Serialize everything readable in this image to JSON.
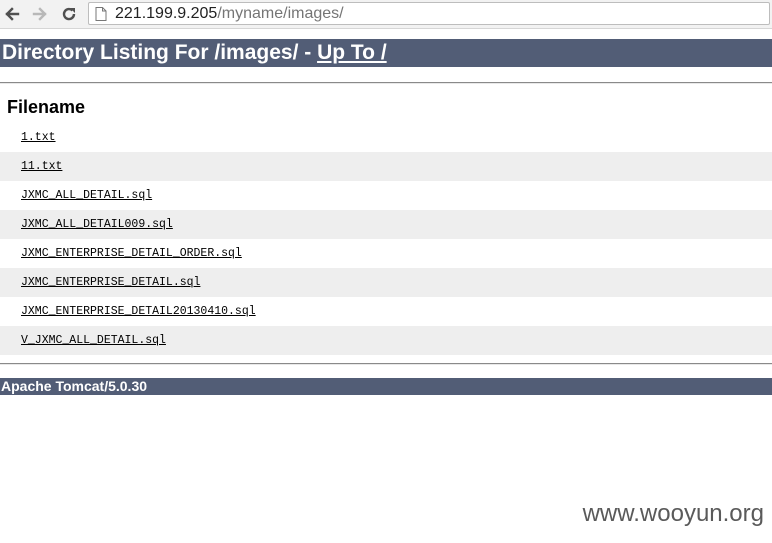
{
  "browser": {
    "url_host": "221.199.9.205",
    "url_path": "/myname/images/"
  },
  "page": {
    "heading_prefix": "Directory Listing For /images/ - ",
    "up_link": "Up To /",
    "column_header": "Filename",
    "files": [
      "1.txt",
      "11.txt",
      "JXMC_ALL_DETAIL.sql",
      "JXMC_ALL_DETAIL009.sql",
      "JXMC_ENTERPRISE_DETAIL_ORDER.sql",
      "JXMC_ENTERPRISE_DETAIL.sql",
      "JXMC_ENTERPRISE_DETAIL20130410.sql",
      "V_JXMC_ALL_DETAIL.sql"
    ],
    "footer": "Apache Tomcat/5.0.30"
  },
  "watermark": "www.wooyun.org",
  "colors": {
    "header_bg": "#525d76",
    "row_shade": "#eeeeee"
  }
}
